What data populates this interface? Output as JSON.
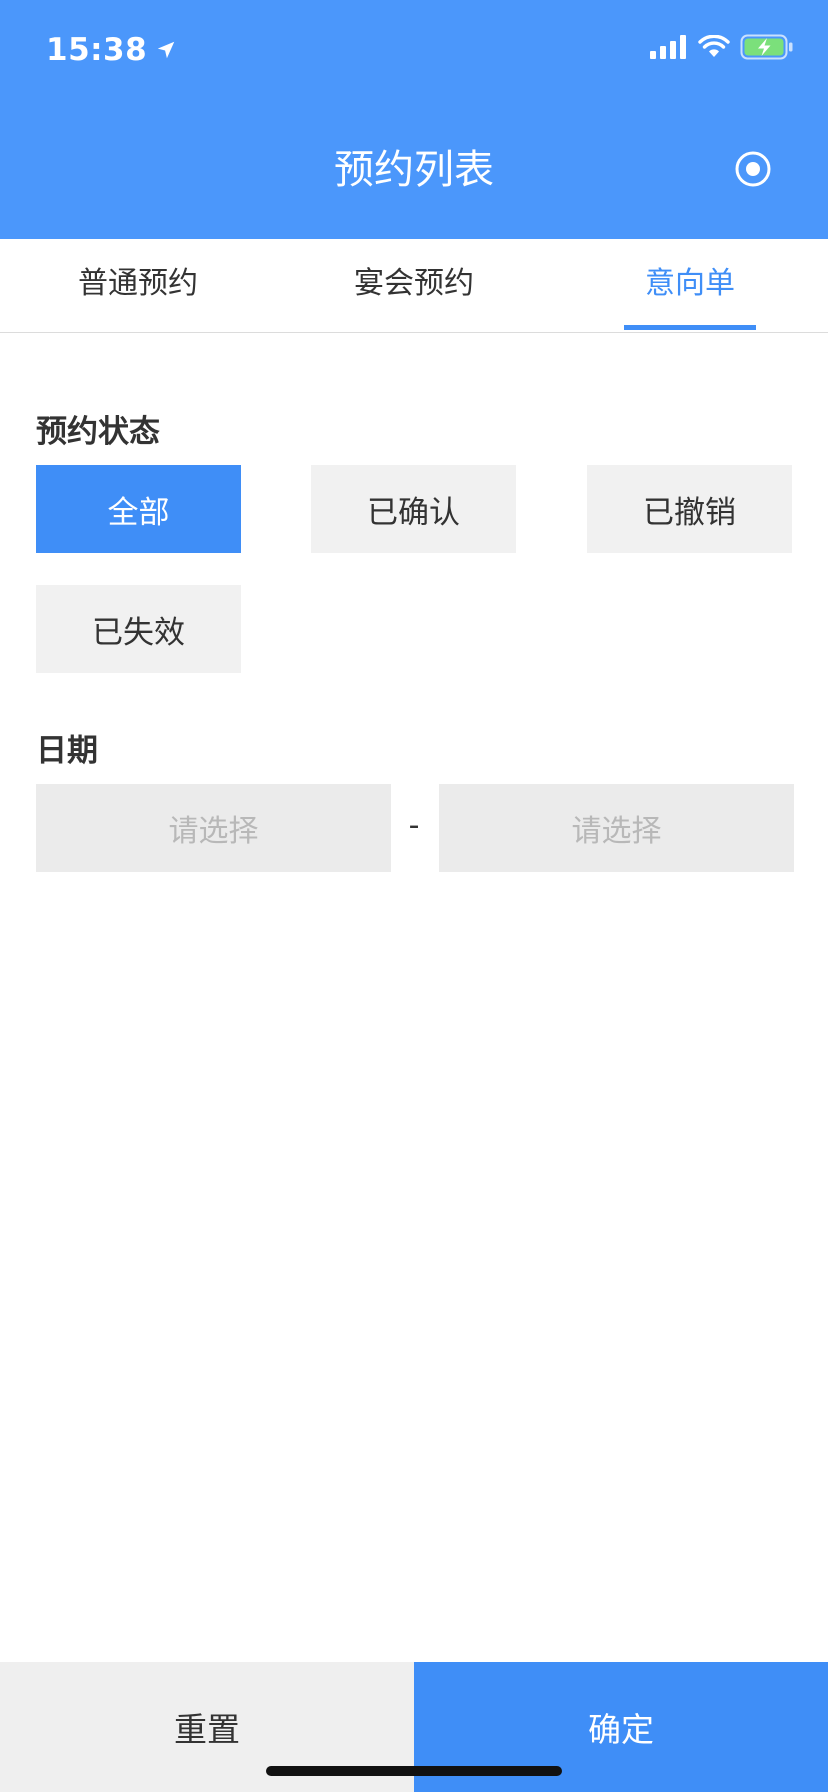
{
  "status_bar": {
    "time": "15:38",
    "icons": [
      "location-arrow-icon",
      "signal-icon",
      "wifi-icon",
      "battery-charging-icon"
    ],
    "battery_color": "#7be07b"
  },
  "header": {
    "title": "预约列表",
    "right_icon": "record-icon",
    "background": "#4b97fb"
  },
  "tabs": [
    {
      "label": "普通预约",
      "active": false
    },
    {
      "label": "宴会预约",
      "active": false
    },
    {
      "label": "意向单",
      "active": true
    }
  ],
  "filter": {
    "status_label": "预约状态",
    "status_options": [
      {
        "label": "全部",
        "selected": true
      },
      {
        "label": "已确认",
        "selected": false
      },
      {
        "label": "已撤销",
        "selected": false
      },
      {
        "label": "已失效",
        "selected": false
      }
    ],
    "date_label": "日期",
    "date_start_placeholder": "请选择",
    "date_separator": "-",
    "date_end_placeholder": "请选择"
  },
  "footer": {
    "reset_label": "重置",
    "confirm_label": "确定"
  },
  "colors": {
    "accent": "#3f8ef7",
    "option_bg": "#f1f1f1",
    "input_bg": "#ebebeb"
  }
}
